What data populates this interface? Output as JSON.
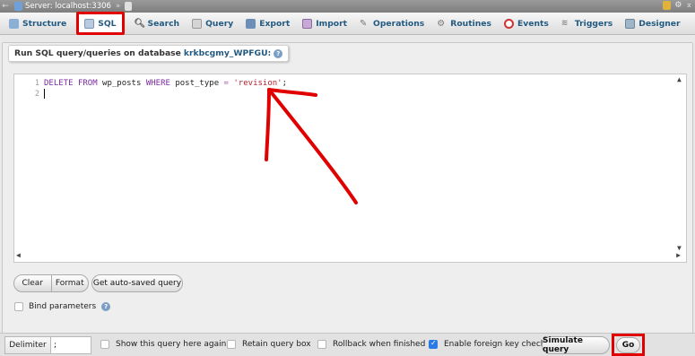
{
  "topbar": {
    "server_label": "Server: localhost:3306",
    "separator": "»"
  },
  "tabs": [
    {
      "label": "Structure",
      "icon": "structure-icon"
    },
    {
      "label": "SQL",
      "icon": "sql-icon"
    },
    {
      "label": "Search",
      "icon": "search-icon"
    },
    {
      "label": "Query",
      "icon": "query-icon"
    },
    {
      "label": "Export",
      "icon": "export-icon"
    },
    {
      "label": "Import",
      "icon": "import-icon"
    },
    {
      "label": "Operations",
      "icon": "wrench-icon"
    },
    {
      "label": "Routines",
      "icon": "routines-icon"
    },
    {
      "label": "Events",
      "icon": "clock-icon"
    },
    {
      "label": "Triggers",
      "icon": "triggers-icon"
    },
    {
      "label": "Designer",
      "icon": "designer-icon"
    }
  ],
  "panel": {
    "legend_prefix": "Run SQL query/queries on database",
    "database": "krkbcgmy_WPFGU:"
  },
  "editor": {
    "line_numbers": [
      "1",
      "2"
    ],
    "tokens": {
      "kw_delete": "DELETE",
      "kw_from": "FROM",
      "table": "wp_posts",
      "kw_where": "WHERE",
      "column": "post_type",
      "op": "=",
      "str": "'revision'",
      "semi": ";"
    }
  },
  "buttons": {
    "clear": "Clear",
    "format": "Format",
    "autosaved": "Get auto-saved query"
  },
  "bind_parameters": "Bind parameters",
  "bottom": {
    "delimiter_label": "Delimiter",
    "delimiter_value": ";",
    "show_query": "Show this query here again",
    "retain_box": "Retain query box",
    "rollback": "Rollback when finished",
    "foreign_keys": "Enable foreign key checks",
    "simulate": "Simulate query",
    "go": "Go"
  },
  "colors": {
    "link": "#235a81",
    "highlight": "#e00000",
    "checkbox_on": "#2c7be5"
  }
}
